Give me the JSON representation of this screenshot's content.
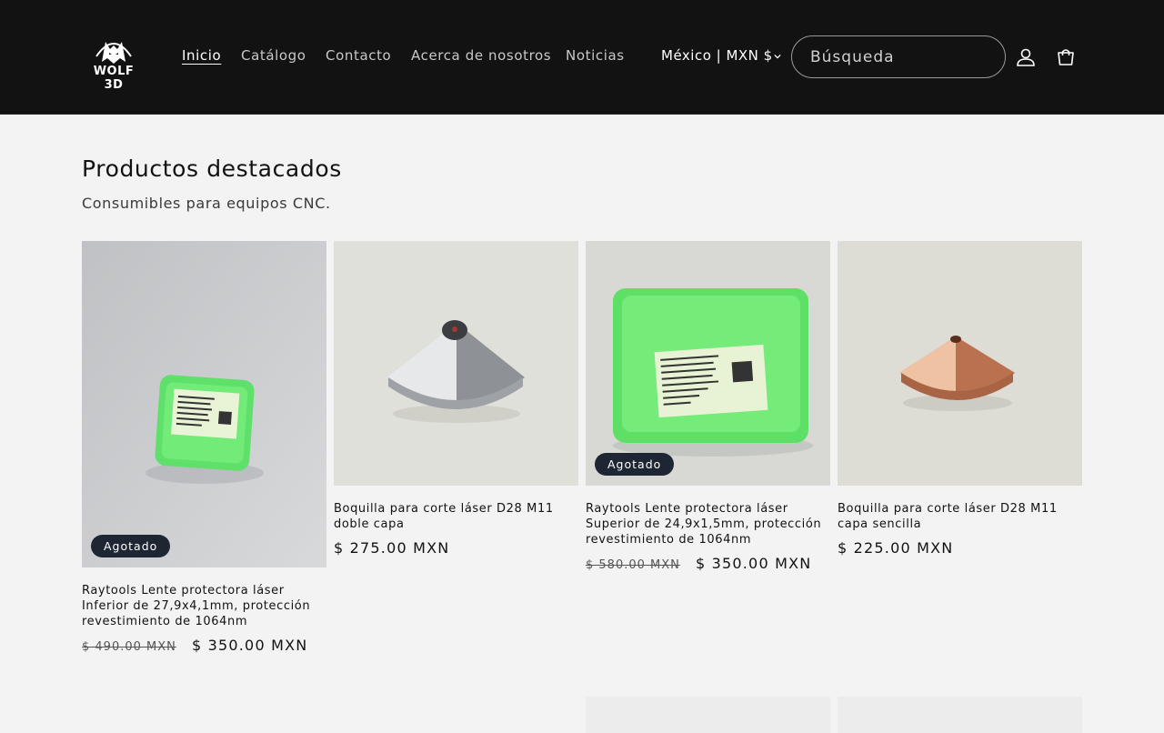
{
  "brand": {
    "logo_text": "WOLF 3D"
  },
  "nav": {
    "items": [
      {
        "label": "Inicio",
        "active": true
      },
      {
        "label": "Catálogo",
        "active": false
      },
      {
        "label": "Contacto",
        "active": false
      },
      {
        "label": "Acerca de nosotros",
        "active": false
      },
      {
        "label": "Noticias",
        "active": false
      }
    ]
  },
  "header": {
    "country_selector": "México | MXN $",
    "search_placeholder": "Búsqueda",
    "account_icon": "user-icon",
    "cart_icon": "cart-icon"
  },
  "section": {
    "title": "Productos destacados",
    "subtitle": "Consumibles para equipos CNC."
  },
  "products": [
    {
      "title": "Raytools Lente protectora láser Inferior de 27,9x4,1mm, protección revestimiento de 1064nm",
      "price_old": "$ 490.00 MXN",
      "price_new": "$ 350.00 MXN",
      "badge": "Agotado",
      "image": "lens-box-green"
    },
    {
      "title": "Boquilla para corte láser D28 M11 doble capa",
      "price_old": "",
      "price_new": "$ 275.00 MXN",
      "badge": "",
      "image": "nozzle-silver"
    },
    {
      "title": "Raytools Lente protectora láser Superior de 24,9x1,5mm, protección revestimiento de 1064nm",
      "price_old": "$ 580.00 MXN",
      "price_new": "$ 350.00 MXN",
      "badge": "Agotado",
      "image": "lens-box-green"
    },
    {
      "title": "Boquilla para corte láser D28 M11 capa sencilla",
      "price_old": "",
      "price_new": "$ 225.00 MXN",
      "badge": "",
      "image": "nozzle-copper"
    }
  ],
  "colors": {
    "header_bg": "#121212",
    "page_bg": "#f3f3f3",
    "badge_bg": "#1f2633",
    "case_green": "#5fe06a",
    "copper": "#d9906a"
  }
}
